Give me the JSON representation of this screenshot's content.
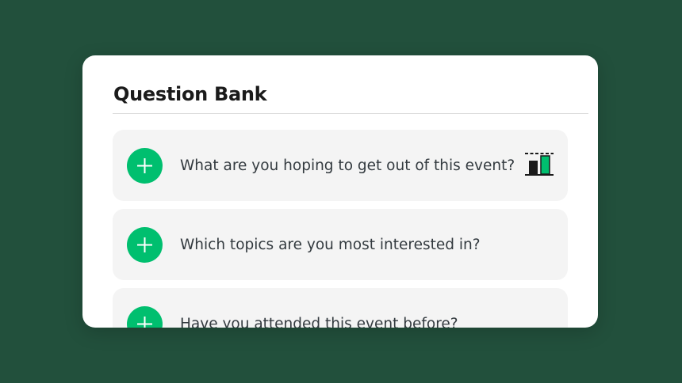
{
  "panel": {
    "title": "Question Bank"
  },
  "questions": [
    {
      "text": "What are you hoping to get out of this event?",
      "add_icon": "plus-icon",
      "badge_icon": "bar-chart-icon"
    },
    {
      "text": "Which topics are you most interested in?",
      "add_icon": "plus-icon"
    },
    {
      "text": "Have you attended this event before?",
      "add_icon": "plus-icon"
    }
  ],
  "colors": {
    "background": "#22503c",
    "accent": "#00bf6f",
    "item_background": "#f4f4f4",
    "title_text": "#1b1b1b",
    "body_text": "#333a3f"
  }
}
